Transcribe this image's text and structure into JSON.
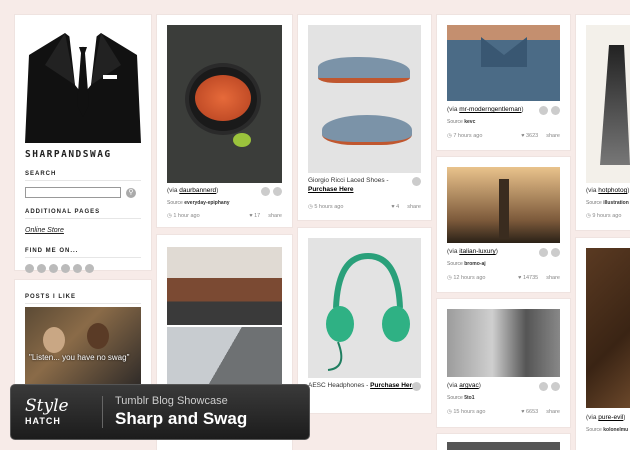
{
  "sidebar": {
    "brand": "SHARPANDSWAG",
    "search_heading": "SEARCH",
    "additional_heading": "ADDITIONAL PAGES",
    "online_store": "Online Store",
    "find_heading": "FIND ME ON...",
    "posts_heading": "POSTS I LIKE",
    "posts_quote": "\"Listen... you have no swag\""
  },
  "posts": [
    {
      "via": "daurbannerd",
      "source": "everyday-epiphany",
      "time": "1 hour ago",
      "likes": "17",
      "share": "share"
    },
    {
      "caption": "Giorgio Ricci Laced Shoes -",
      "link": "Purchase Here",
      "time": "5 hours ago",
      "likes": "4",
      "share": "share"
    },
    {
      "via": "mr-moderngentleman",
      "source": "kevc",
      "time": "7 hours ago",
      "likes": "3623",
      "share": "share"
    },
    {
      "via": "hotphotog",
      "source": "illustration",
      "time": "9 hours ago"
    },
    {
      "caption": "AESC Headphones -",
      "link": "Purchase Here"
    },
    {
      "via": "italian-luxury",
      "source": "bromo-aj",
      "time": "12 hours ago",
      "likes": "14735",
      "share": "share"
    },
    {
      "via": "argvac",
      "source": "5to1",
      "time": "15 hours ago",
      "likes": "6653",
      "share": "share"
    },
    {
      "via": "pure-evil",
      "source": "kolonelmu"
    }
  ],
  "overlay": {
    "logo1": "Style",
    "logo2": "HATCH",
    "line1": "Tumblr Blog Showcase",
    "line2": "Sharp and Swag"
  }
}
